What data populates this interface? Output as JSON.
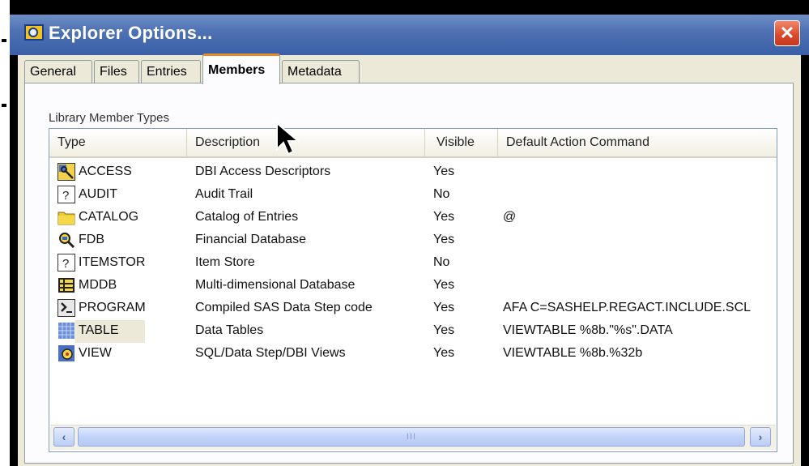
{
  "window": {
    "title": "Explorer Options...",
    "close_symbol": "✕"
  },
  "tabs": [
    {
      "label": "General",
      "active": false
    },
    {
      "label": "Files",
      "active": false
    },
    {
      "label": "Entries",
      "active": false
    },
    {
      "label": "Members",
      "active": true
    },
    {
      "label": "Metadata",
      "active": false
    }
  ],
  "group_label": "Library Member Types",
  "columns": [
    "Type",
    "Description",
    "Visible",
    "Default Action Command"
  ],
  "rows": [
    {
      "type": "ACCESS",
      "description": "DBI Access Descriptors",
      "visible": "Yes",
      "command": "",
      "icon": "key-icon"
    },
    {
      "type": "AUDIT",
      "description": "Audit Trail",
      "visible": "No",
      "command": "",
      "icon": "question-icon"
    },
    {
      "type": "CATALOG",
      "description": "Catalog of Entries",
      "visible": "Yes",
      "command": "@",
      "icon": "folder-icon"
    },
    {
      "type": "FDB",
      "description": "Financial Database",
      "visible": "Yes",
      "command": "",
      "icon": "magnifier-icon"
    },
    {
      "type": "ITEMSTOR",
      "description": "Item Store",
      "visible": "No",
      "command": "",
      "icon": "question-icon"
    },
    {
      "type": "MDDB",
      "description": "Multi-dimensional Database",
      "visible": "Yes",
      "command": "",
      "icon": "cube-icon"
    },
    {
      "type": "PROGRAM",
      "description": "Compiled SAS Data Step code",
      "visible": "Yes",
      "command": "AFA C=SASHELP.REGACT.INCLUDE.SCL",
      "icon": "program-icon"
    },
    {
      "type": "TABLE",
      "description": "Data Tables",
      "visible": "Yes",
      "command": "VIEWTABLE %8b.\"%s\".DATA",
      "icon": "table-icon",
      "selected": true
    },
    {
      "type": "VIEW",
      "description": "SQL/Data Step/DBI Views",
      "visible": "Yes",
      "command": "VIEWTABLE %8b.%32b",
      "icon": "view-icon"
    }
  ],
  "scrollbar": {
    "left_arrow": "‹",
    "right_arrow": "›",
    "grip": "III"
  },
  "colors": {
    "titlebar": "#4f72b4",
    "close": "#d9472a",
    "tab_highlight": "#e68b2c",
    "dialog_bg": "#ece9d8"
  }
}
